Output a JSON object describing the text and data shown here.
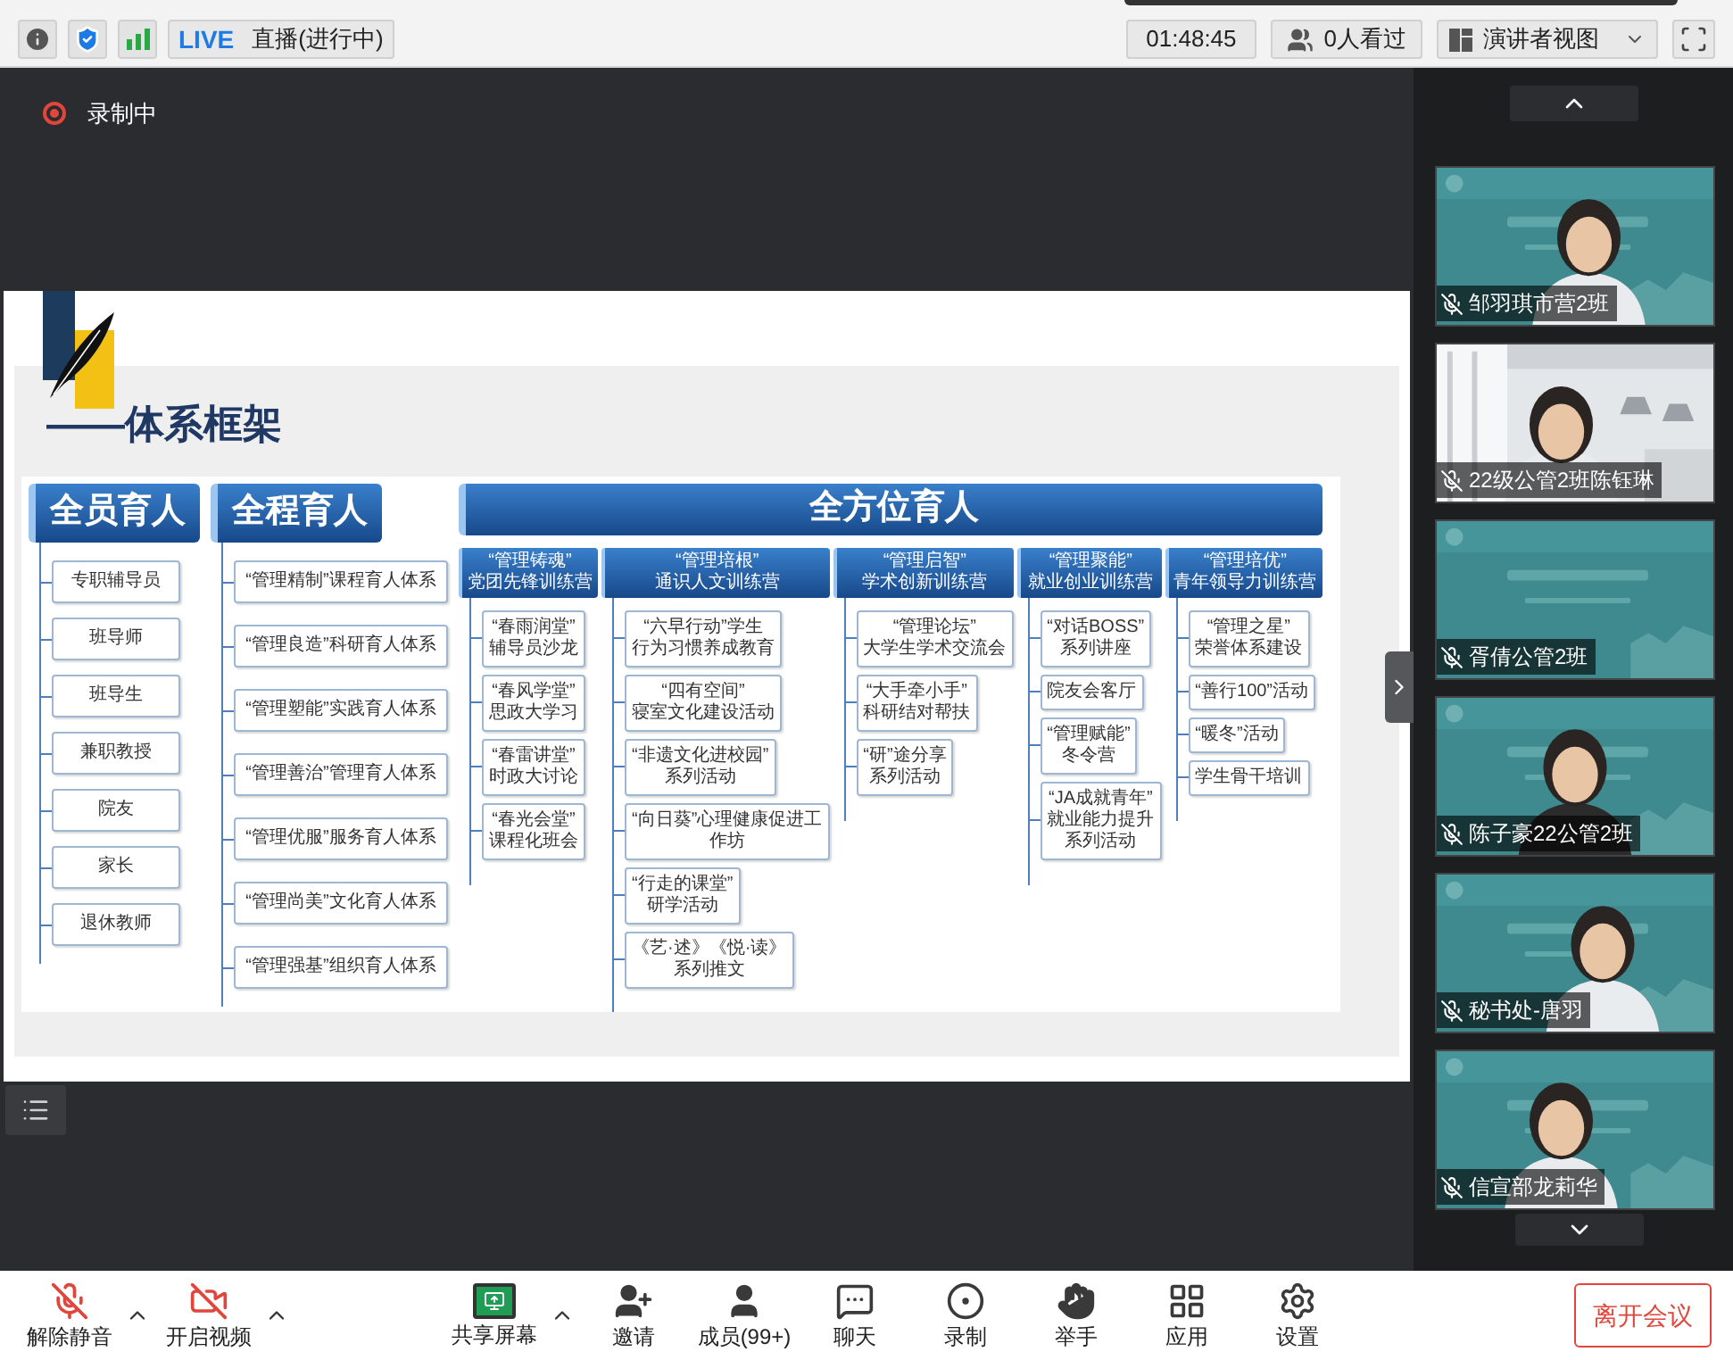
{
  "top_bar": {
    "live_badge": "LIVE",
    "live_status": "直播(进行中)",
    "timer": "01:48:45",
    "viewers": "0人看过",
    "view_mode": "演讲者视图"
  },
  "recording": {
    "label": "录制中"
  },
  "slide": {
    "title": "——体系框架",
    "columns": [
      {
        "title": "全员育人",
        "items": [
          "专职辅导员",
          "班导师",
          "班导生",
          "兼职教授",
          "院友",
          "家长",
          "退休教师"
        ]
      },
      {
        "title": "全程育人",
        "items": [
          "“管理精制”课程育人体系",
          "“管理良造”科研育人体系",
          "“管理塑能”实践育人体系",
          "“管理善治”管理育人体系",
          "“管理优服”服务育人体系",
          "“管理尚美”文化育人体系",
          "“管理强基”组织育人体系"
        ]
      }
    ],
    "wide_header": "全方位育人",
    "groups": [
      {
        "title": "“管理铸魂”",
        "subtitle": "党团先锋训练营",
        "items": [
          [
            "“春雨润堂”",
            "辅导员沙龙"
          ],
          [
            "“春风学堂”",
            "思政大学习"
          ],
          [
            "“春雷讲堂”",
            "时政大讨论"
          ],
          [
            "“春光会堂”",
            "课程化班会"
          ]
        ]
      },
      {
        "title": "“管理培根”",
        "subtitle": "通识人文训练营",
        "items": [
          [
            "“六早行动”学生",
            "行为习惯养成教育"
          ],
          [
            "“四有空间”",
            "寝室文化建设活动"
          ],
          [
            "“非遗文化进校园”",
            "系列活动"
          ],
          [
            "“向日葵”心理健康促进工",
            "作坊"
          ],
          [
            "“行走的课堂”",
            "研学活动"
          ],
          [
            "《艺·述》《悦·读》",
            "系列推文"
          ]
        ]
      },
      {
        "title": "“管理启智”",
        "subtitle": "学术创新训练营",
        "items": [
          [
            "“管理论坛”",
            "大学生学术交流会"
          ],
          [
            "“大手牵小手”",
            "科研结对帮扶"
          ],
          [
            "“研”途分享",
            "系列活动"
          ]
        ]
      },
      {
        "title": "“管理聚能”",
        "subtitle": "就业创业训练营",
        "items": [
          [
            "“对话BOSS”",
            "系列讲座"
          ],
          [
            "院友会客厅"
          ],
          [
            "“管理赋能”",
            "冬令营"
          ],
          [
            "“JA成就青年”",
            "就业能力提升",
            "系列活动"
          ]
        ]
      },
      {
        "title": "“管理培优”",
        "subtitle": "青年领导力训练营",
        "items": [
          [
            "“管理之星”",
            "荣誉体系建设"
          ],
          [
            "“善行100”活动"
          ],
          [
            "“暖冬”活动"
          ],
          [
            "学生骨干培训"
          ]
        ]
      }
    ]
  },
  "participants": [
    {
      "name": "邹羽琪市营2班",
      "muted": true
    },
    {
      "name": "22级公管2班陈钰琳",
      "muted": true
    },
    {
      "name": "胥倩公管2班",
      "muted": true
    },
    {
      "name": "陈子豪22公管2班",
      "muted": true
    },
    {
      "name": "秘书处-唐羽",
      "muted": true
    },
    {
      "name": "信宣部龙莉华",
      "muted": true
    }
  ],
  "toolbar": [
    {
      "kind": "mic",
      "label": "解除静音",
      "off": true,
      "has_menu": true
    },
    {
      "kind": "video",
      "label": "开启视频",
      "off": true,
      "has_menu": true
    },
    {
      "kind": "share",
      "label": "共享屏幕",
      "has_menu": true
    },
    {
      "kind": "invite",
      "label": "邀请",
      "has_menu": false
    },
    {
      "kind": "members",
      "label": "成员(99+)",
      "has_menu": false
    },
    {
      "kind": "chat",
      "label": "聊天",
      "has_menu": false
    },
    {
      "kind": "record",
      "label": "录制",
      "has_menu": false
    },
    {
      "kind": "hand",
      "label": "举手",
      "has_menu": false
    },
    {
      "kind": "apps",
      "label": "应用",
      "has_menu": false
    },
    {
      "kind": "settings",
      "label": "设置",
      "has_menu": false
    }
  ],
  "leave_button": "离开会议"
}
